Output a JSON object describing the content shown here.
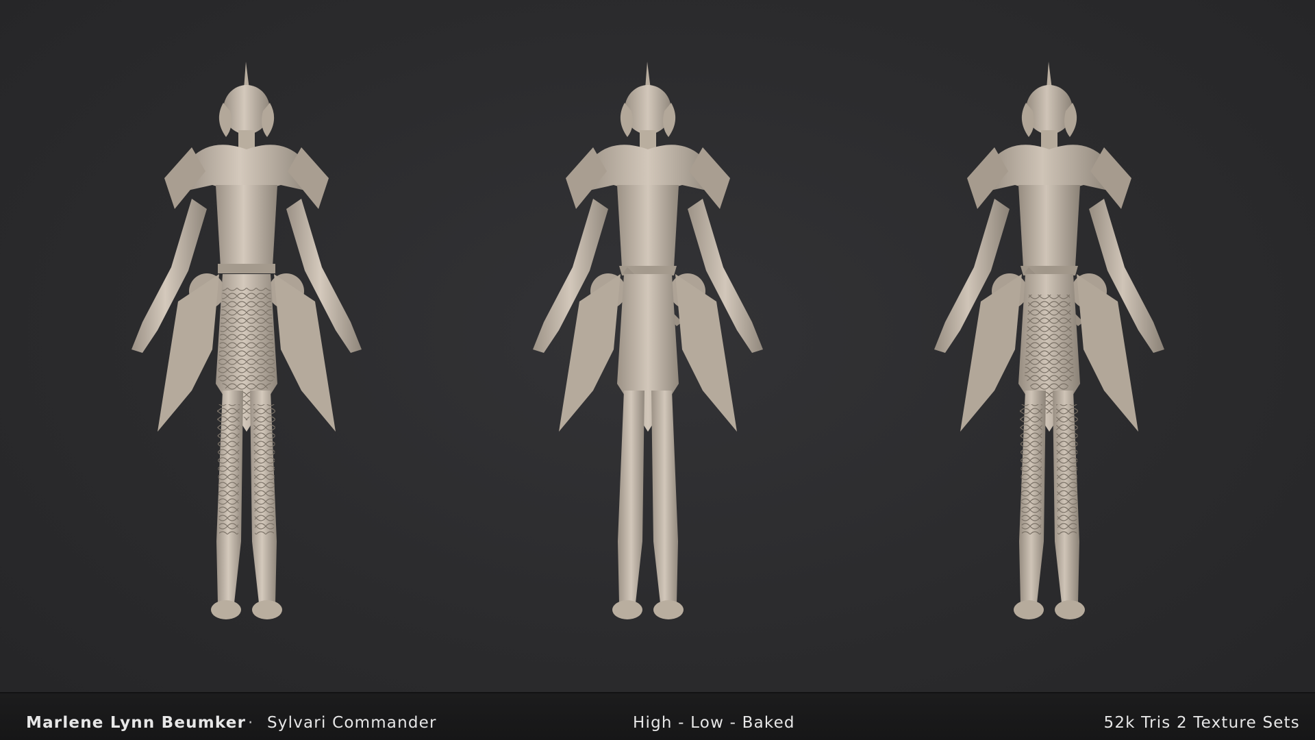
{
  "caption": {
    "artist": "Marlene Lynn Beumker",
    "separator": "·",
    "title": "Sylvari Commander",
    "stages": "High - Low - Baked",
    "stats": "52k Tris 2 Texture Sets"
  },
  "renders": [
    {
      "icon": "character-render-high-poly",
      "tone": "#c9beb1",
      "detail": "high"
    },
    {
      "icon": "character-render-low-poly",
      "tone": "#c7bdb0",
      "detail": "low"
    },
    {
      "icon": "character-render-baked",
      "tone": "#c4b9ab",
      "detail": "baked"
    }
  ],
  "colors": {
    "background": "#2b2b2d",
    "caption_bar": "#1a1a1b",
    "caption_text": "#e7e7e7"
  }
}
